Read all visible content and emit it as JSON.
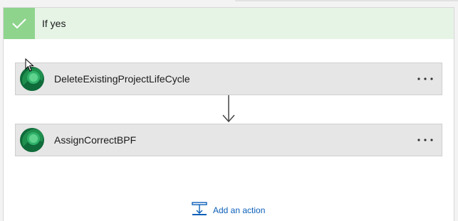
{
  "condition": {
    "branch_title": "If yes",
    "header_color": "#e6f4e6",
    "check_color": "#8fd48d"
  },
  "actions": [
    {
      "label": "DeleteExistingProjectLifeCycle",
      "icon": "dataverse-icon",
      "menu_icon": "more-options-icon"
    },
    {
      "label": "AssignCorrectBPF",
      "icon": "dataverse-icon",
      "menu_icon": "more-options-icon"
    }
  ],
  "footer": {
    "add_action_label": "Add an action",
    "add_action_icon": "insert-step-icon",
    "link_color": "#0b5fb8"
  }
}
